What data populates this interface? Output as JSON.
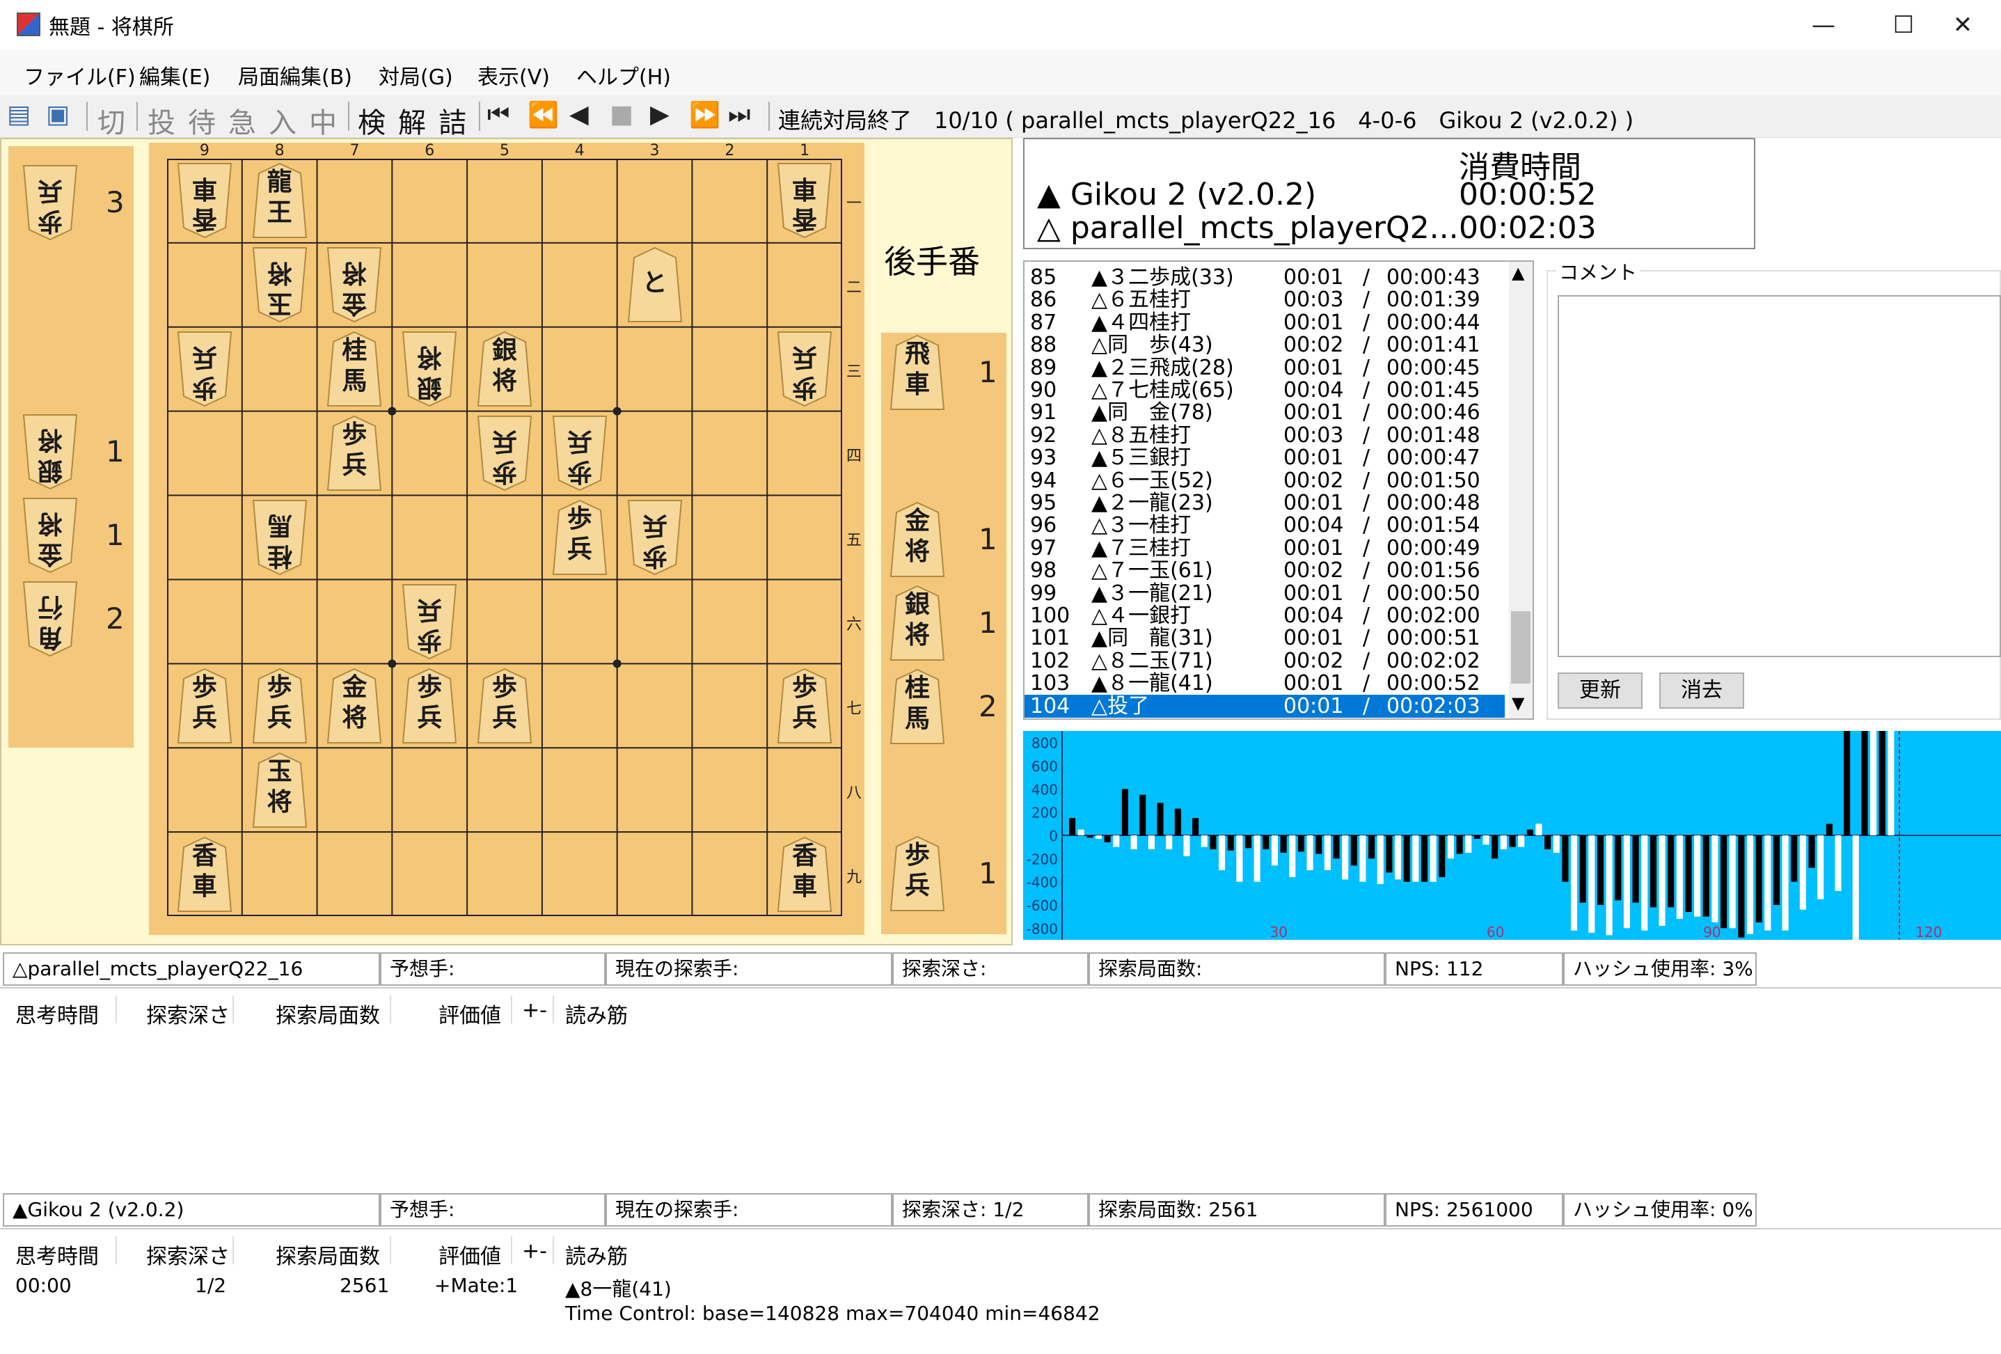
{
  "window": {
    "title": "無題 - 将棋所",
    "controls": [
      "—",
      "☐",
      "✕"
    ]
  },
  "menu": [
    "ファイル(F)",
    "編集(E)",
    "局面編集(B)",
    "対局(G)",
    "表示(V)",
    "ヘルプ(H)"
  ],
  "toolbar": {
    "kanji_buttons": [
      "切",
      "投",
      "待",
      "急",
      "入",
      "中",
      "検",
      "解",
      "詰"
    ],
    "nav_buttons": [
      "⏮",
      "⏪",
      "◀",
      "■",
      "▶",
      "⏩",
      "⏭"
    ],
    "status": "連続対局終了　10/10 ( parallel_mcts_playerQ22_16　4-0-6　Gikou 2 (v2.0.2) )"
  },
  "board": {
    "col_labels": [
      "9",
      "8",
      "7",
      "6",
      "5",
      "4",
      "3",
      "2",
      "1"
    ],
    "row_labels": [
      "一",
      "二",
      "三",
      "四",
      "五",
      "六",
      "七",
      "八",
      "九"
    ],
    "turn_label": "後手番",
    "pieces": [
      {
        "row": 0,
        "col": 0,
        "text": "香\n車",
        "gote": true
      },
      {
        "row": 0,
        "col": 1,
        "text": "龍\n王",
        "gote": false
      },
      {
        "row": 0,
        "col": 8,
        "text": "香\n車",
        "gote": true
      },
      {
        "row": 1,
        "col": 1,
        "text": "玉\n将",
        "gote": true
      },
      {
        "row": 1,
        "col": 2,
        "text": "金\n将",
        "gote": true
      },
      {
        "row": 1,
        "col": 6,
        "text": "と",
        "gote": false
      },
      {
        "row": 2,
        "col": 0,
        "text": "歩\n兵",
        "gote": true
      },
      {
        "row": 2,
        "col": 2,
        "text": "桂\n馬",
        "gote": false
      },
      {
        "row": 2,
        "col": 3,
        "text": "銀\n将",
        "gote": true
      },
      {
        "row": 2,
        "col": 4,
        "text": "銀\n将",
        "gote": false
      },
      {
        "row": 2,
        "col": 8,
        "text": "歩\n兵",
        "gote": true
      },
      {
        "row": 3,
        "col": 2,
        "text": "歩\n兵",
        "gote": false
      },
      {
        "row": 3,
        "col": 4,
        "text": "歩\n兵",
        "gote": true
      },
      {
        "row": 3,
        "col": 5,
        "text": "歩\n兵",
        "gote": true
      },
      {
        "row": 4,
        "col": 1,
        "text": "桂\n馬",
        "gote": true
      },
      {
        "row": 4,
        "col": 5,
        "text": "歩\n兵",
        "gote": false
      },
      {
        "row": 4,
        "col": 6,
        "text": "歩\n兵",
        "gote": true
      },
      {
        "row": 5,
        "col": 3,
        "text": "歩\n兵",
        "gote": true
      },
      {
        "row": 6,
        "col": 0,
        "text": "歩\n兵",
        "gote": false
      },
      {
        "row": 6,
        "col": 1,
        "text": "歩\n兵",
        "gote": false
      },
      {
        "row": 6,
        "col": 2,
        "text": "金\n将",
        "gote": false
      },
      {
        "row": 6,
        "col": 3,
        "text": "歩\n兵",
        "gote": false
      },
      {
        "row": 6,
        "col": 4,
        "text": "歩\n兵",
        "gote": false
      },
      {
        "row": 6,
        "col": 8,
        "text": "歩\n兵",
        "gote": false
      },
      {
        "row": 7,
        "col": 1,
        "text": "玉\n将",
        "gote": false
      },
      {
        "row": 8,
        "col": 0,
        "text": "香\n車",
        "gote": false
      },
      {
        "row": 8,
        "col": 8,
        "text": "香\n車",
        "gote": false
      }
    ],
    "gote_hand": [
      {
        "text": "歩\n兵",
        "count": "3"
      },
      {
        "text": "銀\n将",
        "count": "1"
      },
      {
        "text": "金\n将",
        "count": "1"
      },
      {
        "text": "角\n行",
        "count": "2"
      }
    ],
    "sente_hand": [
      {
        "text": "飛\n車",
        "count": "1"
      },
      {
        "text": "金\n将",
        "count": "1"
      },
      {
        "text": "銀\n将",
        "count": "1"
      },
      {
        "text": "桂\n馬",
        "count": "2"
      },
      {
        "text": "歩\n兵",
        "count": "1"
      }
    ]
  },
  "time_panel": {
    "header": "消費時間",
    "sente_name": "▲ Gikou 2 (v2.0.2)",
    "sente_time": "00:00:52",
    "gote_name": "△ parallel_mcts_playerQ2...",
    "gote_time": "00:02:03"
  },
  "kifu": [
    {
      "no": "85",
      "move": "▲３二歩成(33)",
      "t": "00:01",
      "total": "00:00:43"
    },
    {
      "no": "86",
      "move": "△６五桂打",
      "t": "00:03",
      "total": "00:01:39"
    },
    {
      "no": "87",
      "move": "▲４四桂打",
      "t": "00:01",
      "total": "00:00:44"
    },
    {
      "no": "88",
      "move": "△同　歩(43)",
      "t": "00:02",
      "total": "00:01:41"
    },
    {
      "no": "89",
      "move": "▲２三飛成(28)",
      "t": "00:01",
      "total": "00:00:45"
    },
    {
      "no": "90",
      "move": "△７七桂成(65)",
      "t": "00:04",
      "total": "00:01:45"
    },
    {
      "no": "91",
      "move": "▲同　金(78)",
      "t": "00:01",
      "total": "00:00:46"
    },
    {
      "no": "92",
      "move": "△８五桂打",
      "t": "00:03",
      "total": "00:01:48"
    },
    {
      "no": "93",
      "move": "▲５三銀打",
      "t": "00:01",
      "total": "00:00:47"
    },
    {
      "no": "94",
      "move": "△６一玉(52)",
      "t": "00:02",
      "total": "00:01:50"
    },
    {
      "no": "95",
      "move": "▲２一龍(23)",
      "t": "00:01",
      "total": "00:00:48"
    },
    {
      "no": "96",
      "move": "△３一桂打",
      "t": "00:04",
      "total": "00:01:54"
    },
    {
      "no": "97",
      "move": "▲７三桂打",
      "t": "00:01",
      "total": "00:00:49"
    },
    {
      "no": "98",
      "move": "△７一玉(61)",
      "t": "00:02",
      "total": "00:01:56"
    },
    {
      "no": "99",
      "move": "▲３一龍(21)",
      "t": "00:01",
      "total": "00:00:50"
    },
    {
      "no": "100",
      "move": "△４一銀打",
      "t": "00:04",
      "total": "00:02:00"
    },
    {
      "no": "101",
      "move": "▲同　龍(31)",
      "t": "00:01",
      "total": "00:00:51"
    },
    {
      "no": "102",
      "move": "△８二玉(71)",
      "t": "00:02",
      "total": "00:02:02"
    },
    {
      "no": "103",
      "move": "▲８一龍(41)",
      "t": "00:01",
      "total": "00:00:52"
    },
    {
      "no": "104",
      "move": "△投了",
      "t": "00:01",
      "total": "00:02:03"
    }
  ],
  "kifu_sep": "/",
  "comment": {
    "label": "コメント",
    "update_button": "更新",
    "clear_button": "消去"
  },
  "chart_data": {
    "type": "bar",
    "ylim": [
      -900,
      900
    ],
    "xlim": [
      0,
      130
    ],
    "y_ticks": [
      "800",
      "600",
      "400",
      "200",
      "0",
      "-200",
      "-400",
      "-600",
      "-800"
    ],
    "x_ticks": [
      "30",
      "60",
      "90",
      "120"
    ],
    "grid": false,
    "series": [
      {
        "color": "#000000",
        "values": [
          150,
          -20,
          -60,
          400,
          350,
          280,
          230,
          150,
          -120,
          -130,
          -110,
          -120,
          -150,
          -140,
          -160,
          -200,
          -260,
          -200,
          -320,
          -400,
          -400,
          -360,
          -160,
          -30,
          -200,
          -100,
          50,
          -120,
          -400,
          -580,
          -600,
          -560,
          -580,
          -620,
          -620,
          -660,
          -700,
          -800,
          -880,
          -750,
          -600,
          -400,
          -280,
          100,
          1200,
          1200,
          1200
        ]
      },
      {
        "color": "#ffffff",
        "values": [
          50,
          -30,
          -100,
          -120,
          -120,
          -120,
          -180,
          -100,
          -300,
          -400,
          -400,
          -260,
          -360,
          -300,
          -300,
          -380,
          -400,
          -420,
          -380,
          -400,
          -400,
          -200,
          -150,
          -80,
          -120,
          -100,
          100,
          -150,
          -820,
          -840,
          -860,
          -800,
          -820,
          -780,
          -720,
          -700,
          -750,
          -800,
          -850,
          -820,
          -820,
          -640,
          -550,
          -480,
          -950,
          1200,
          1200
        ]
      }
    ]
  },
  "engine1": {
    "name": "△parallel_mcts_playerQ22_16",
    "predict": "予想手:",
    "current": "現在の探索手:",
    "depth": "探索深さ:",
    "nodes": "探索局面数:",
    "nps": "NPS: 112",
    "hash": "ハッシュ使用率: 3%"
  },
  "engine2": {
    "name": "▲Gikou 2 (v2.0.2)",
    "predict": "予想手:",
    "current": "現在の探索手:",
    "depth": "探索深さ: 1/2",
    "nodes": "探索局面数: 2561",
    "nps": "NPS: 2561000",
    "hash": "ハッシュ使用率: 0%"
  },
  "columns": [
    "思考時間",
    "探索深さ",
    "探索局面数",
    "評価値",
    "+-",
    "読み筋"
  ],
  "engine2_row": {
    "time": "00:00",
    "depth": "1/2",
    "nodes": "2561",
    "eval": "+Mate:1",
    "pv": "▲8一龍(41)",
    "pv2": "Time Control: base=140828 max=704040 min=46842"
  }
}
